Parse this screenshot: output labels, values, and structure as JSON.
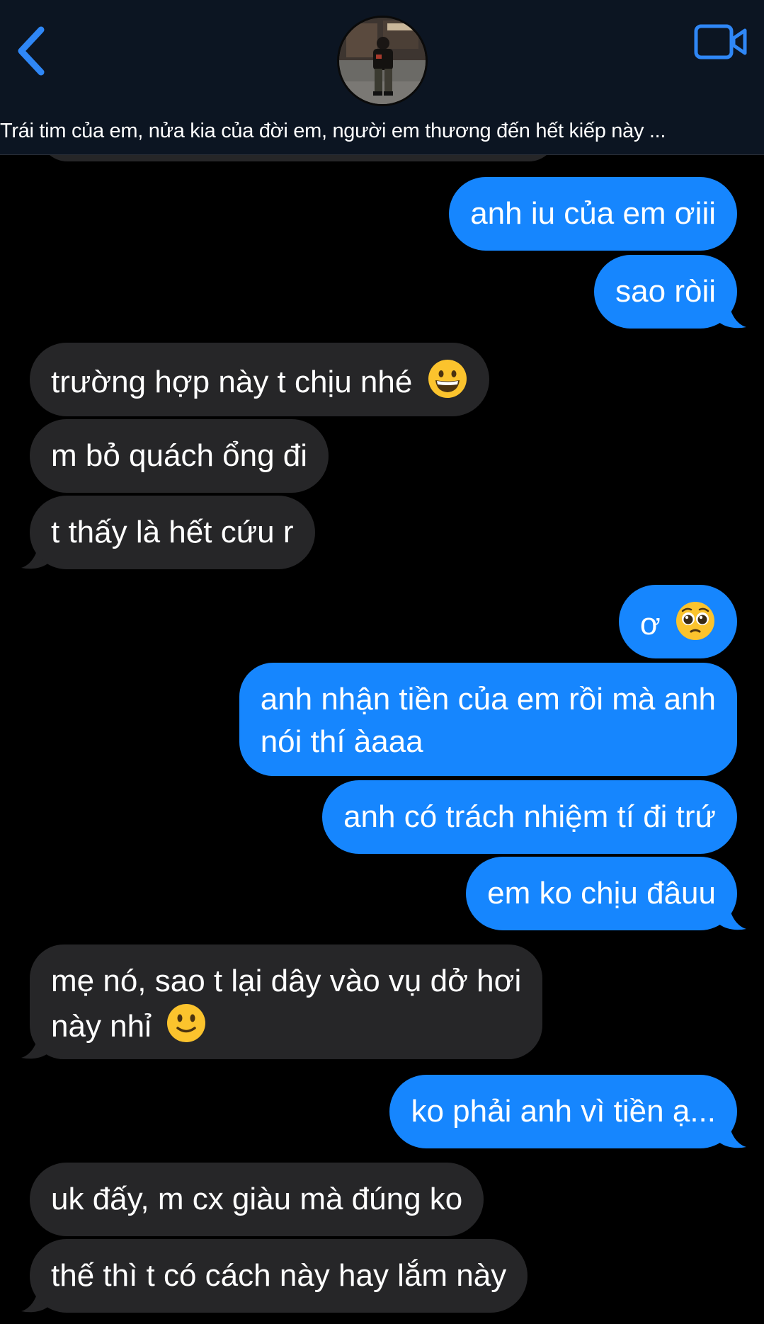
{
  "header": {
    "back_icon": "chevron-left-icon",
    "video_icon": "video-camera-icon",
    "avatar_icon": "contact-avatar-photo",
    "contact_name": "Trái tim của em, nửa kia của đời em, người em thương đến hết kiếp này ..."
  },
  "colors": {
    "sent_bubble": "#1686fe",
    "received_bubble": "#262628",
    "background": "#000000",
    "header_background": "#0c1522",
    "accent": "#2f87f6"
  },
  "messages": [
    {
      "side": "sent",
      "text": "anh iu của em ơiii"
    },
    {
      "side": "sent",
      "text": "sao ròii"
    },
    {
      "side": "received",
      "text": "trường hợp này t chịu nhé",
      "emoji": "grinning-face"
    },
    {
      "side": "received",
      "text": "m bỏ quách ổng đi"
    },
    {
      "side": "received",
      "text": "t thấy là hết cứu r"
    },
    {
      "side": "sent",
      "text": "ơ",
      "emoji": "pleading-face"
    },
    {
      "side": "sent",
      "line1": "anh nhận tiền của em rồi mà anh",
      "line2": "nói thí àaaa"
    },
    {
      "side": "sent",
      "text": "anh có trách nhiệm tí đi trứ"
    },
    {
      "side": "sent",
      "text": "em ko chịu đâuu"
    },
    {
      "side": "received",
      "line1": "mẹ nó, sao t lại dây vào vụ dở hơi",
      "line2": "này nhỉ",
      "emoji": "slightly-smiling-face"
    },
    {
      "side": "sent",
      "text": "ko phải anh vì tiền ạ..."
    },
    {
      "side": "received",
      "text": "uk đấy, m cx giàu mà đúng ko"
    },
    {
      "side": "received",
      "text": "thế thì t có cách này hay lắm này"
    }
  ]
}
